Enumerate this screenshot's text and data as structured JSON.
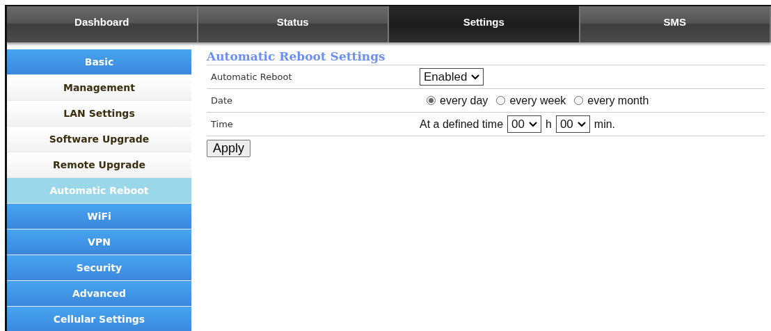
{
  "nav_tabs": [
    {
      "label": "Dashboard",
      "selected": false
    },
    {
      "label": "Status",
      "selected": false
    },
    {
      "label": "Settings",
      "selected": true
    },
    {
      "label": "SMS",
      "selected": false
    }
  ],
  "sidebar": {
    "items": [
      {
        "label": "Basic",
        "kind": "group",
        "selected": false
      },
      {
        "label": "Management",
        "kind": "sub",
        "selected": false
      },
      {
        "label": "LAN Settings",
        "kind": "sub",
        "selected": false
      },
      {
        "label": "Software Upgrade",
        "kind": "sub",
        "selected": false
      },
      {
        "label": "Remote Upgrade",
        "kind": "sub",
        "selected": false
      },
      {
        "label": "Automatic Reboot",
        "kind": "sub",
        "selected": true
      },
      {
        "label": "WiFi",
        "kind": "group",
        "selected": false
      },
      {
        "label": "VPN",
        "kind": "group",
        "selected": false
      },
      {
        "label": "Security",
        "kind": "group",
        "selected": false
      },
      {
        "label": "Advanced",
        "kind": "group",
        "selected": false
      },
      {
        "label": "Cellular Settings",
        "kind": "group",
        "selected": false
      }
    ]
  },
  "content": {
    "title": "Automatic Reboot Settings",
    "rows": [
      {
        "label": "Automatic Reboot",
        "kind": "select",
        "value": "Enabled"
      },
      {
        "label": "Date",
        "kind": "radios",
        "options": [
          {
            "label": "every day",
            "selected": true
          },
          {
            "label": "every week",
            "selected": false
          },
          {
            "label": "every month",
            "selected": false
          }
        ]
      },
      {
        "label": "Time",
        "kind": "time",
        "prefix": "At a defined time",
        "hour": "00",
        "hour_unit": "h",
        "minute": "00",
        "minute_unit": "min."
      }
    ],
    "apply_button": "Apply"
  }
}
